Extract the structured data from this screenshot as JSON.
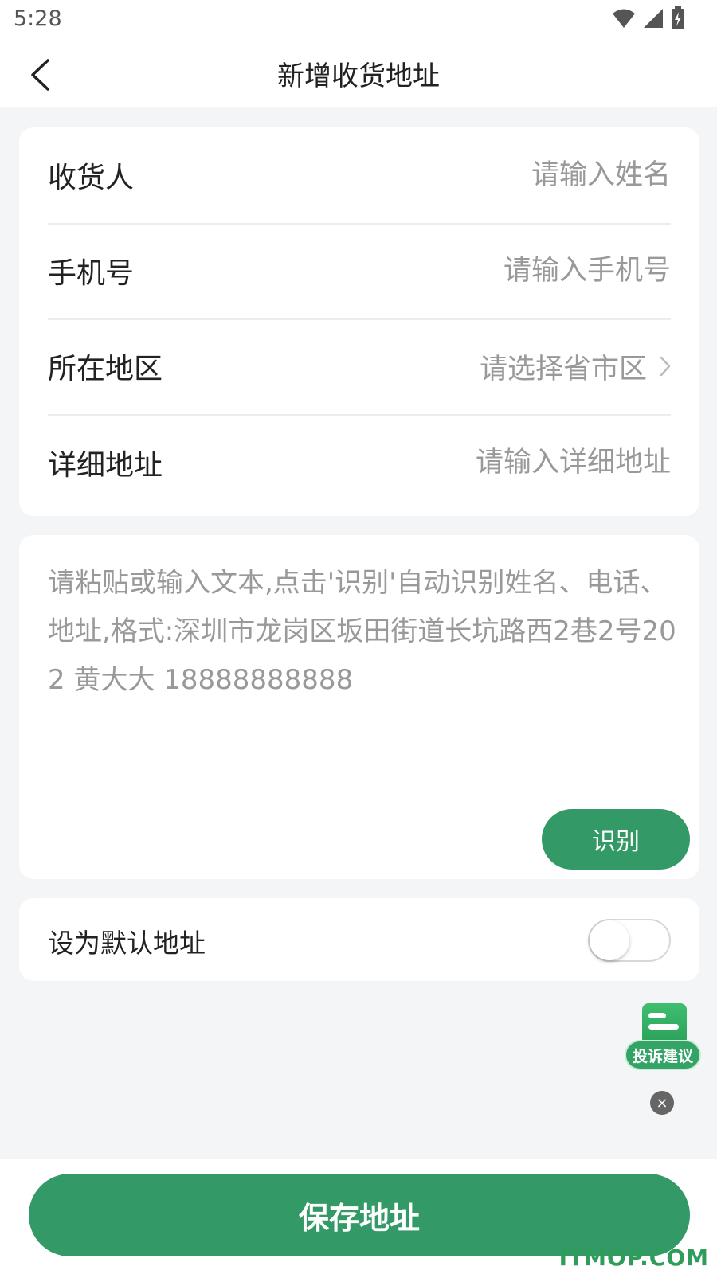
{
  "status_bar": {
    "time": "5:28",
    "icons": [
      "wifi-icon",
      "signal-icon",
      "battery-charging-icon"
    ]
  },
  "app_bar": {
    "title": "新增收货地址",
    "back_icon": "chevron-left-icon"
  },
  "form": {
    "rows": [
      {
        "label": "收货人",
        "placeholder": "请输入姓名"
      },
      {
        "label": "手机号",
        "placeholder": "请输入手机号"
      },
      {
        "label": "所在地区",
        "placeholder": "请选择省市区",
        "icon": "chevron-right-icon"
      },
      {
        "label": "详细地址",
        "placeholder": "请输入详细地址"
      }
    ]
  },
  "smart_paste": {
    "placeholder": "请粘贴或输入文本,点击'识别'自动识别姓名、电话、地址,格式:深圳市龙岗区坂田街道长坑路西2巷2号202 黄大大 18888888888",
    "recognize_label": "识别"
  },
  "default_address": {
    "label": "设为默认地址",
    "enabled": false
  },
  "feedback": {
    "label": "投诉建议",
    "close_glyph": "×"
  },
  "save_button": {
    "label": "保存地址"
  },
  "watermark": "ITMOP.COM",
  "colors": {
    "primary": "#339966",
    "background": "#f4f5f7",
    "placeholder": "#999999"
  }
}
